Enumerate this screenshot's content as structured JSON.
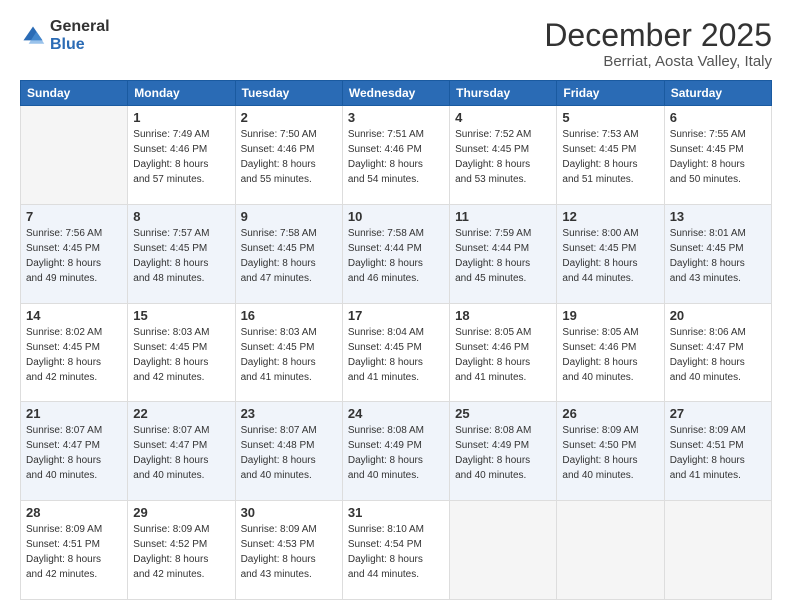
{
  "header": {
    "logo_general": "General",
    "logo_blue": "Blue",
    "month": "December 2025",
    "location": "Berriat, Aosta Valley, Italy"
  },
  "weekdays": [
    "Sunday",
    "Monday",
    "Tuesday",
    "Wednesday",
    "Thursday",
    "Friday",
    "Saturday"
  ],
  "weeks": [
    [
      {
        "day": "",
        "sunrise": "",
        "sunset": "",
        "daylight": "",
        "empty": true
      },
      {
        "day": "1",
        "sunrise": "7:49 AM",
        "sunset": "4:46 PM",
        "daylight": "8 hours and 57 minutes."
      },
      {
        "day": "2",
        "sunrise": "7:50 AM",
        "sunset": "4:46 PM",
        "daylight": "8 hours and 55 minutes."
      },
      {
        "day": "3",
        "sunrise": "7:51 AM",
        "sunset": "4:46 PM",
        "daylight": "8 hours and 54 minutes."
      },
      {
        "day": "4",
        "sunrise": "7:52 AM",
        "sunset": "4:45 PM",
        "daylight": "8 hours and 53 minutes."
      },
      {
        "day": "5",
        "sunrise": "7:53 AM",
        "sunset": "4:45 PM",
        "daylight": "8 hours and 51 minutes."
      },
      {
        "day": "6",
        "sunrise": "7:55 AM",
        "sunset": "4:45 PM",
        "daylight": "8 hours and 50 minutes."
      }
    ],
    [
      {
        "day": "7",
        "sunrise": "7:56 AM",
        "sunset": "4:45 PM",
        "daylight": "8 hours and 49 minutes."
      },
      {
        "day": "8",
        "sunrise": "7:57 AM",
        "sunset": "4:45 PM",
        "daylight": "8 hours and 48 minutes."
      },
      {
        "day": "9",
        "sunrise": "7:58 AM",
        "sunset": "4:45 PM",
        "daylight": "8 hours and 47 minutes."
      },
      {
        "day": "10",
        "sunrise": "7:58 AM",
        "sunset": "4:44 PM",
        "daylight": "8 hours and 46 minutes."
      },
      {
        "day": "11",
        "sunrise": "7:59 AM",
        "sunset": "4:44 PM",
        "daylight": "8 hours and 45 minutes."
      },
      {
        "day": "12",
        "sunrise": "8:00 AM",
        "sunset": "4:45 PM",
        "daylight": "8 hours and 44 minutes."
      },
      {
        "day": "13",
        "sunrise": "8:01 AM",
        "sunset": "4:45 PM",
        "daylight": "8 hours and 43 minutes."
      }
    ],
    [
      {
        "day": "14",
        "sunrise": "8:02 AM",
        "sunset": "4:45 PM",
        "daylight": "8 hours and 42 minutes."
      },
      {
        "day": "15",
        "sunrise": "8:03 AM",
        "sunset": "4:45 PM",
        "daylight": "8 hours and 42 minutes."
      },
      {
        "day": "16",
        "sunrise": "8:03 AM",
        "sunset": "4:45 PM",
        "daylight": "8 hours and 41 minutes."
      },
      {
        "day": "17",
        "sunrise": "8:04 AM",
        "sunset": "4:45 PM",
        "daylight": "8 hours and 41 minutes."
      },
      {
        "day": "18",
        "sunrise": "8:05 AM",
        "sunset": "4:46 PM",
        "daylight": "8 hours and 41 minutes."
      },
      {
        "day": "19",
        "sunrise": "8:05 AM",
        "sunset": "4:46 PM",
        "daylight": "8 hours and 40 minutes."
      },
      {
        "day": "20",
        "sunrise": "8:06 AM",
        "sunset": "4:47 PM",
        "daylight": "8 hours and 40 minutes."
      }
    ],
    [
      {
        "day": "21",
        "sunrise": "8:07 AM",
        "sunset": "4:47 PM",
        "daylight": "8 hours and 40 minutes."
      },
      {
        "day": "22",
        "sunrise": "8:07 AM",
        "sunset": "4:47 PM",
        "daylight": "8 hours and 40 minutes."
      },
      {
        "day": "23",
        "sunrise": "8:07 AM",
        "sunset": "4:48 PM",
        "daylight": "8 hours and 40 minutes."
      },
      {
        "day": "24",
        "sunrise": "8:08 AM",
        "sunset": "4:49 PM",
        "daylight": "8 hours and 40 minutes."
      },
      {
        "day": "25",
        "sunrise": "8:08 AM",
        "sunset": "4:49 PM",
        "daylight": "8 hours and 40 minutes."
      },
      {
        "day": "26",
        "sunrise": "8:09 AM",
        "sunset": "4:50 PM",
        "daylight": "8 hours and 40 minutes."
      },
      {
        "day": "27",
        "sunrise": "8:09 AM",
        "sunset": "4:51 PM",
        "daylight": "8 hours and 41 minutes."
      }
    ],
    [
      {
        "day": "28",
        "sunrise": "8:09 AM",
        "sunset": "4:51 PM",
        "daylight": "8 hours and 42 minutes."
      },
      {
        "day": "29",
        "sunrise": "8:09 AM",
        "sunset": "4:52 PM",
        "daylight": "8 hours and 42 minutes."
      },
      {
        "day": "30",
        "sunrise": "8:09 AM",
        "sunset": "4:53 PM",
        "daylight": "8 hours and 43 minutes."
      },
      {
        "day": "31",
        "sunrise": "8:10 AM",
        "sunset": "4:54 PM",
        "daylight": "8 hours and 44 minutes."
      },
      {
        "day": "",
        "sunrise": "",
        "sunset": "",
        "daylight": "",
        "empty": true
      },
      {
        "day": "",
        "sunrise": "",
        "sunset": "",
        "daylight": "",
        "empty": true
      },
      {
        "day": "",
        "sunrise": "",
        "sunset": "",
        "daylight": "",
        "empty": true
      }
    ]
  ]
}
